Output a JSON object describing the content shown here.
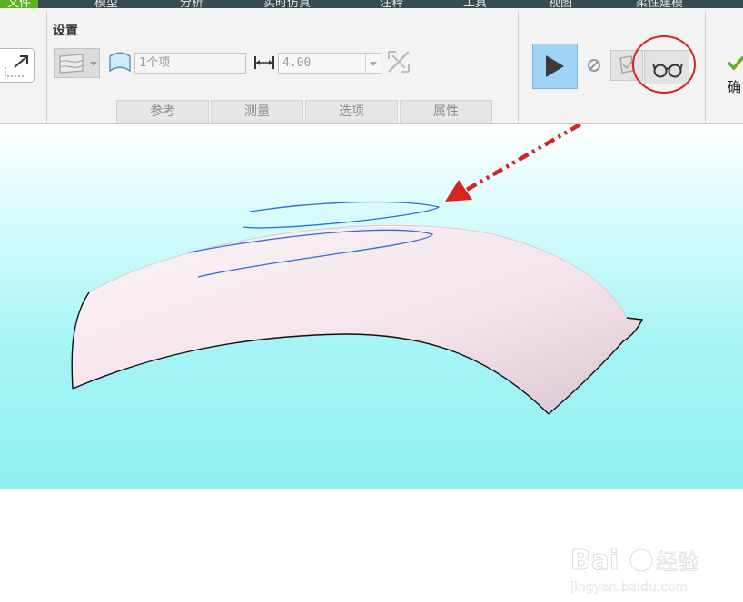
{
  "top_tabs": [
    {
      "label": "文件",
      "active": true
    },
    {
      "label": "模型",
      "active": false
    },
    {
      "label": "分析",
      "active": false
    },
    {
      "label": "实时仿真",
      "active": false
    },
    {
      "label": "注释",
      "active": false
    },
    {
      "label": "工具",
      "active": false
    },
    {
      "label": "视图",
      "active": false
    },
    {
      "label": "柔性建模",
      "active": false
    }
  ],
  "settings": {
    "title": "设置",
    "reference_placeholder": "1个项",
    "thickness_value": "4.00"
  },
  "sub_tabs": [
    "参考",
    "测量",
    "选项",
    "属性"
  ],
  "actions": {
    "confirm_label": "确"
  },
  "watermark": {
    "brand_text": "Bai",
    "brand_text2": "经验",
    "url": "jingyan.baidu.com"
  },
  "colors": {
    "accent_green": "#5db11e",
    "play_button_bg": "#9fd4f7",
    "highlight_red": "#d52424",
    "curve_blue": "#2f6fd6"
  }
}
